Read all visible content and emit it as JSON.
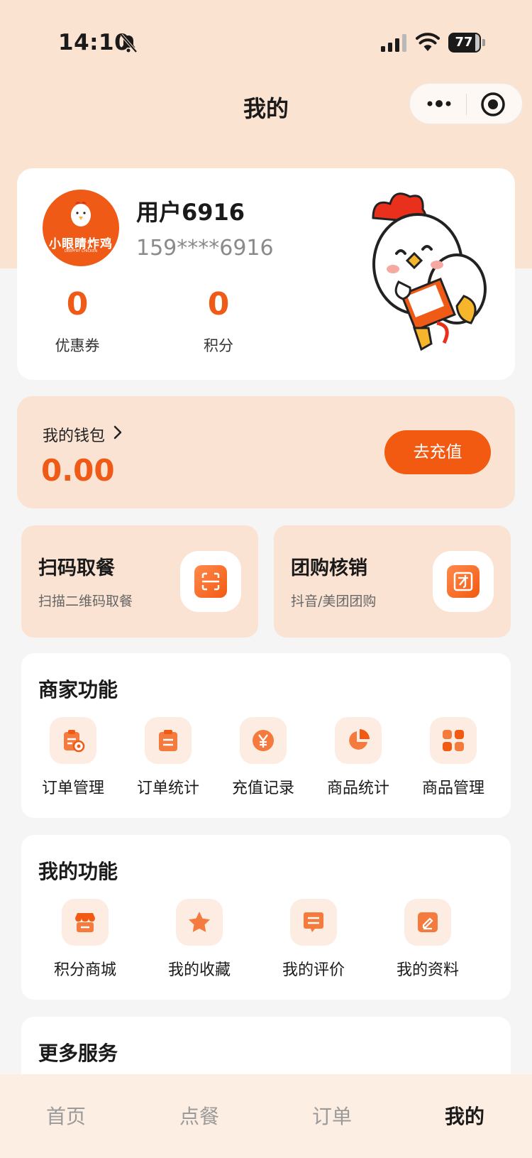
{
  "status_bar": {
    "time": "14:10",
    "battery": "77"
  },
  "header": {
    "title": "我的"
  },
  "profile": {
    "avatar_text": "小眼睛炸鸡",
    "avatar_subtext": "DEEPFRY CHICKEN",
    "username": "用户6916",
    "phone": "159****6916",
    "coupons": {
      "value": "0",
      "label": "优惠券"
    },
    "points": {
      "value": "0",
      "label": "积分"
    }
  },
  "wallet": {
    "label": "我的钱包",
    "balance": "0.00",
    "recharge_label": "去充值"
  },
  "quick_actions": [
    {
      "title": "扫码取餐",
      "subtitle": "扫描二维码取餐",
      "icon": "scan-icon"
    },
    {
      "title": "团购核销",
      "subtitle": "抖音/美团团购",
      "icon": "group-buy-icon"
    }
  ],
  "merchant": {
    "title": "商家功能",
    "items": [
      {
        "label": "订单管理",
        "icon": "order-manage-icon"
      },
      {
        "label": "订单统计",
        "icon": "order-stats-icon"
      },
      {
        "label": "充值记录",
        "icon": "yen-icon"
      },
      {
        "label": "商品统计",
        "icon": "pie-chart-icon"
      },
      {
        "label": "商品管理",
        "icon": "grid-icon"
      }
    ]
  },
  "mine": {
    "title": "我的功能",
    "items": [
      {
        "label": "积分商城",
        "icon": "shop-icon"
      },
      {
        "label": "我的收藏",
        "icon": "star-icon"
      },
      {
        "label": "我的评价",
        "icon": "comment-icon"
      },
      {
        "label": "我的资料",
        "icon": "edit-icon"
      }
    ]
  },
  "more": {
    "title": "更多服务"
  },
  "tabs": [
    {
      "label": "首页",
      "active": false
    },
    {
      "label": "点餐",
      "active": false
    },
    {
      "label": "订单",
      "active": false
    },
    {
      "label": "我的",
      "active": true
    }
  ],
  "colors": {
    "accent": "#f25a12",
    "peach": "#fae3d2",
    "background": "#f5f5f5"
  }
}
